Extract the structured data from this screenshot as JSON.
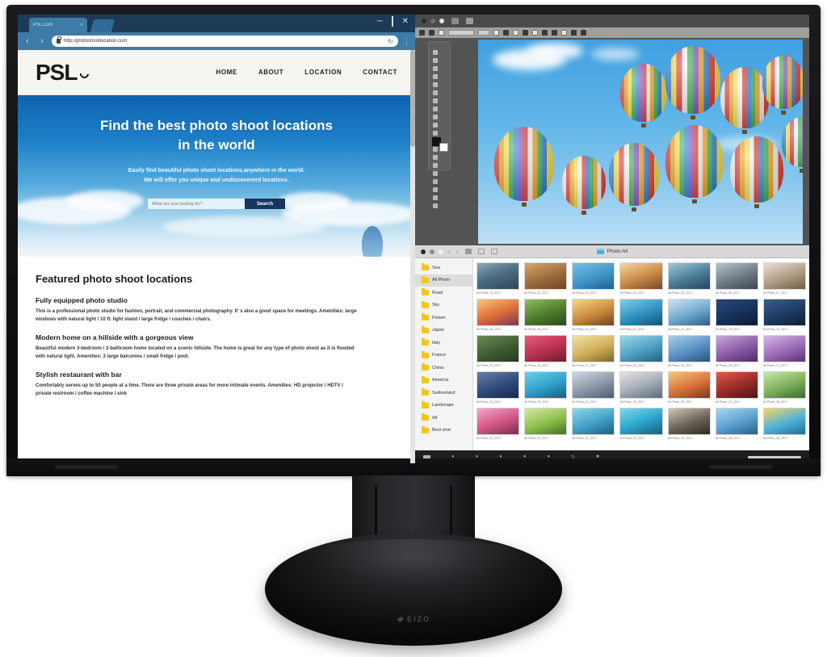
{
  "hardware": {
    "brand": "EIZO",
    "brand_mark_icon": "eizo-diamond-icon"
  },
  "browser": {
    "tab": {
      "title": "PSL.com",
      "close_icon": "close-icon",
      "new_tab_icon": "new-tab-icon"
    },
    "window_controls": {
      "minimize_icon": "minimize-icon",
      "maximize_icon": "maximize-icon",
      "close_icon": "close-icon"
    },
    "toolbar": {
      "back_icon": "chevron-left-icon",
      "forward_icon": "chevron-right-icon",
      "lock_icon": "lock-icon",
      "url": "http://photoshootlocation.com",
      "reload_icon": "reload-icon",
      "menu_icon": "kebab-menu-icon"
    }
  },
  "site": {
    "logo": "PSL",
    "logo_icon": "aperture-icon",
    "nav": [
      {
        "label": "HOME"
      },
      {
        "label": "ABOUT"
      },
      {
        "label": "LOCATION"
      },
      {
        "label": "CONTACT"
      }
    ],
    "hero": {
      "title_line1": "Find the best photo shoot locations",
      "title_line2": "in the world",
      "sub_line1": "Easily find beautiful photo shoot locations,anywhere in the world.",
      "sub_line2": "We will offer you unique and undiscovererd locations.",
      "search_placeholder": "What are you looking for?",
      "search_button": "Search"
    },
    "featured": {
      "heading": "Featured photo shoot locations",
      "listings": [
        {
          "title": "Fully equipped photo studio",
          "desc": "This is a professional photo studio for fashion, portrait, and commercial photography. It’ s also a good space for meetings. Amenities: large windows with natural light / 10 ft. light stand / large fridge / couches / chairs."
        },
        {
          "title": "Modern home on a hillside with a gorgeous view",
          "desc": "Beautiful modern 3-bedroom / 2-bathroom home located on a scenic hillside. The home is great for any type of photo shoot as it is flooded with natural light. Amenities: 3 large balconies / small fridge / pool."
        },
        {
          "title": "Stylish restaurant with bar",
          "desc": "Comfortably serves up to 50 people at a time. There are three private areas for more intimate events. Amenities: HD projector / HDTV / private restroom / coffee machine / sink"
        }
      ]
    }
  },
  "photo_editor": {
    "traffic_lights": [
      "close-dot",
      "minimize-dot",
      "zoom-dot"
    ],
    "tool_palette_icon": "tool-palette",
    "foreground_color": "#111111",
    "background_color": "#ffffff",
    "canvas_subject": "hot-air-balloons"
  },
  "photo_browser": {
    "title": "Photo All",
    "title_icon": "folder-icon",
    "back_icon": "chevron-left-icon",
    "forward_icon": "chevron-right-icon",
    "folders": [
      {
        "label": "Sea",
        "selected": false
      },
      {
        "label": "All Photo",
        "selected": true
      },
      {
        "label": "Road",
        "selected": false
      },
      {
        "label": "Sky",
        "selected": false
      },
      {
        "label": "Flower",
        "selected": false
      },
      {
        "label": "Japan",
        "selected": false
      },
      {
        "label": "Italy",
        "selected": false
      },
      {
        "label": "France",
        "selected": false
      },
      {
        "label": "China",
        "selected": false
      },
      {
        "label": "America",
        "selected": false
      },
      {
        "label": "Switzerland",
        "selected": false
      },
      {
        "label": "Landscape",
        "selected": false
      },
      {
        "label": "All",
        "selected": false
      },
      {
        "label": "Best shot",
        "selected": false
      }
    ],
    "thumbnails": [
      {
        "label": "All Photo_01_2017",
        "color": "linear-gradient(160deg,#8fa8b8,#4f6f84 45%,#2d4458)"
      },
      {
        "label": "All Photo_02_2017",
        "color": "linear-gradient(160deg,#d8a86a,#9c6b3d 55%,#6b4525)"
      },
      {
        "label": "All Photo_03_2017",
        "color": "linear-gradient(160deg,#6fc3e8,#3d8fc4 60%,#1f5f8c)"
      },
      {
        "label": "All Photo_04_2017",
        "color": "linear-gradient(160deg,#f2d9a0,#cf8f4a 50%,#7a4a2a)"
      },
      {
        "label": "All Photo_05_2017",
        "color": "linear-gradient(160deg,#9ec9d8,#4a7a96 55%,#24465e)"
      },
      {
        "label": "All Photo_06_2017",
        "color": "linear-gradient(160deg,#b8c4cc,#6d7a84 55%,#3a4650)"
      },
      {
        "label": "All Photo_07_2017",
        "color": "linear-gradient(160deg,#e8e2d6,#b09a82 55%,#6e5c48)"
      },
      {
        "label": "All Photo_08_2017",
        "color": "linear-gradient(160deg,#f6c87a,#e2713a 50%,#7a3a52)"
      },
      {
        "label": "All Photo_09_2017",
        "color": "linear-gradient(160deg,#8fbf5a,#4f7a2e 55%,#2c4a1c)"
      },
      {
        "label": "All Photo_10_2017",
        "color": "linear-gradient(160deg,#f5d98a,#c98a3a 55%,#6e4420)"
      },
      {
        "label": "All Photo_11_2017",
        "color": "linear-gradient(160deg,#7fd0e8,#2f8fc0 55%,#14526e)"
      },
      {
        "label": "All Photo_12_2017",
        "color": "linear-gradient(160deg,#cfe4f2,#6fa8cc 55%,#2e5f86)"
      },
      {
        "label": "All Photo_13_2017",
        "color": "linear-gradient(160deg,#2a4a7a,#16305c 55%,#0a1b36)"
      },
      {
        "label": "All Photo_14_2017",
        "color": "linear-gradient(160deg,#3a5f8c,#1d3a62 55%,#0c1e3a)"
      },
      {
        "label": "All Photo_15_2017",
        "color": "linear-gradient(160deg,#6b8a5a,#3d5c32 55%,#24381c)"
      },
      {
        "label": "All Photo_16_2017",
        "color": "linear-gradient(160deg,#e85a7a,#b8304f 55%,#6e1c30)"
      },
      {
        "label": "All Photo_17_2017",
        "color": "linear-gradient(160deg,#f2e2a8,#cfae5a 55%,#7a6a2a)"
      },
      {
        "label": "All Photo_18_2017",
        "color": "linear-gradient(160deg,#9ed8e8,#4f9fc4 55%,#24607e)"
      },
      {
        "label": "All Photo_19_2017",
        "color": "linear-gradient(160deg,#a8cfe8,#5a8fc4 55%,#2a5280)"
      },
      {
        "label": "All Photo_20_2017",
        "color": "linear-gradient(160deg,#c8a8d8,#8a5aa8 55%,#4e2c66)"
      },
      {
        "label": "All Photo_21_2017",
        "color": "linear-gradient(160deg,#d8b8e8,#9a6ab8 55%,#5a3670)"
      },
      {
        "label": "All Photo_22_2017",
        "color": "linear-gradient(160deg,#6a7fa8,#2e4a7a 55%,#16284a)"
      },
      {
        "label": "All Photo_23_2017",
        "color": "linear-gradient(160deg,#6fd0e8,#2f9fc8 55%,#14607e)"
      },
      {
        "label": "All Photo_24_2017",
        "color": "linear-gradient(160deg,#cfd8e2,#8a96a8 55%,#4e5a6e)"
      },
      {
        "label": "All Photo_25_2017",
        "color": "linear-gradient(160deg,#e8e2e2,#a8b0bc 50%,#5a6a7a)"
      },
      {
        "label": "All Photo_26_2017",
        "color": "linear-gradient(160deg,#f2c87a,#d8703a 55%,#7a3820)"
      },
      {
        "label": "All Photo_27_2017",
        "color": "linear-gradient(160deg,#e85a4a,#9c2e2a 50%,#4e1614)"
      },
      {
        "label": "All Photo_28_2017",
        "color": "linear-gradient(160deg,#c8e8a8,#7aae5a 55%,#3e6a2e)"
      },
      {
        "label": "All Photo_29_2017",
        "color": "linear-gradient(160deg,#f2a8c8,#d85a8a 50%,#7a2c4a)"
      },
      {
        "label": "All Photo_30_2017",
        "color": "linear-gradient(160deg,#d8e8a8,#8abe4a 55%,#4a6e22)"
      },
      {
        "label": "All Photo_31_2017",
        "color": "linear-gradient(160deg,#8fd8e8,#3fa0c8 55%,#1c5e7e)"
      },
      {
        "label": "All Photo_32_2017",
        "color": "linear-gradient(160deg,#7fd8e8,#2fa8d0 50%,#146080)"
      },
      {
        "label": "All Photo_33_2017",
        "color": "linear-gradient(160deg,#cfc8b8,#6a6258 55%,#2e2a24)"
      },
      {
        "label": "All Photo_34_2017",
        "color": "linear-gradient(160deg,#a8d8f2,#5a9ecf 55%,#2a5e86)"
      },
      {
        "label": "All Photo_35_2017",
        "color": "linear-gradient(160deg,#f2d86a,#4fb0d8 55%,#1c6e96)"
      }
    ]
  }
}
